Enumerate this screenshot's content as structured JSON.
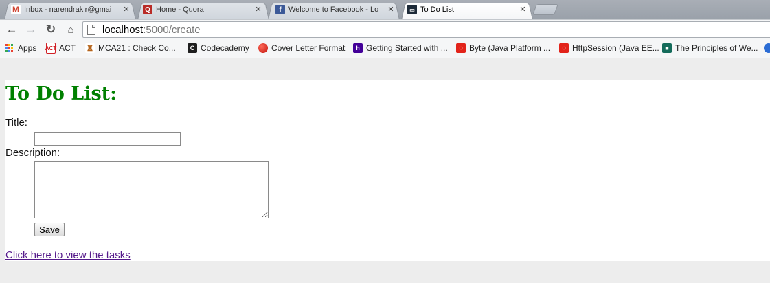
{
  "browser": {
    "tabs": [
      {
        "title": "Inbox - narendraklr@gmai",
        "favicon": "gmail-icon",
        "active": false
      },
      {
        "title": "Home - Quora",
        "favicon": "quora-icon",
        "active": false
      },
      {
        "title": "Welcome to Facebook - Lo",
        "favicon": "facebook-icon",
        "active": false
      },
      {
        "title": "To Do List",
        "favicon": "terminal-icon",
        "active": true
      }
    ],
    "url_host": "localhost",
    "url_rest": ":5000/create",
    "bookmarks": [
      {
        "label": "Apps",
        "icon": "apps-grid-icon"
      },
      {
        "label": "ACT",
        "icon": "act-icon"
      },
      {
        "label": "MCA21 : Check Co...",
        "icon": "emblem-icon"
      },
      {
        "label": "Codecademy",
        "icon": "codecademy-icon"
      },
      {
        "label": "Cover Letter Format",
        "icon": "red-ball-icon"
      },
      {
        "label": "Getting Started with ...",
        "icon": "heroku-icon"
      },
      {
        "label": "Byte (Java Platform ...",
        "icon": "oracle-icon"
      },
      {
        "label": "HttpSession (Java EE...",
        "icon": "oracle-icon"
      },
      {
        "label": "The Principles of We...",
        "icon": "green-square-icon"
      }
    ]
  },
  "page": {
    "heading": "To Do List:",
    "title_label": "Title:",
    "title_value": "",
    "description_label": "Description:",
    "description_value": "",
    "save_label": "Save",
    "view_link": "Click here to view the tasks"
  },
  "colors": {
    "heading": "#008000",
    "visited_link": "#551a8b",
    "page_background": "#ededed"
  }
}
